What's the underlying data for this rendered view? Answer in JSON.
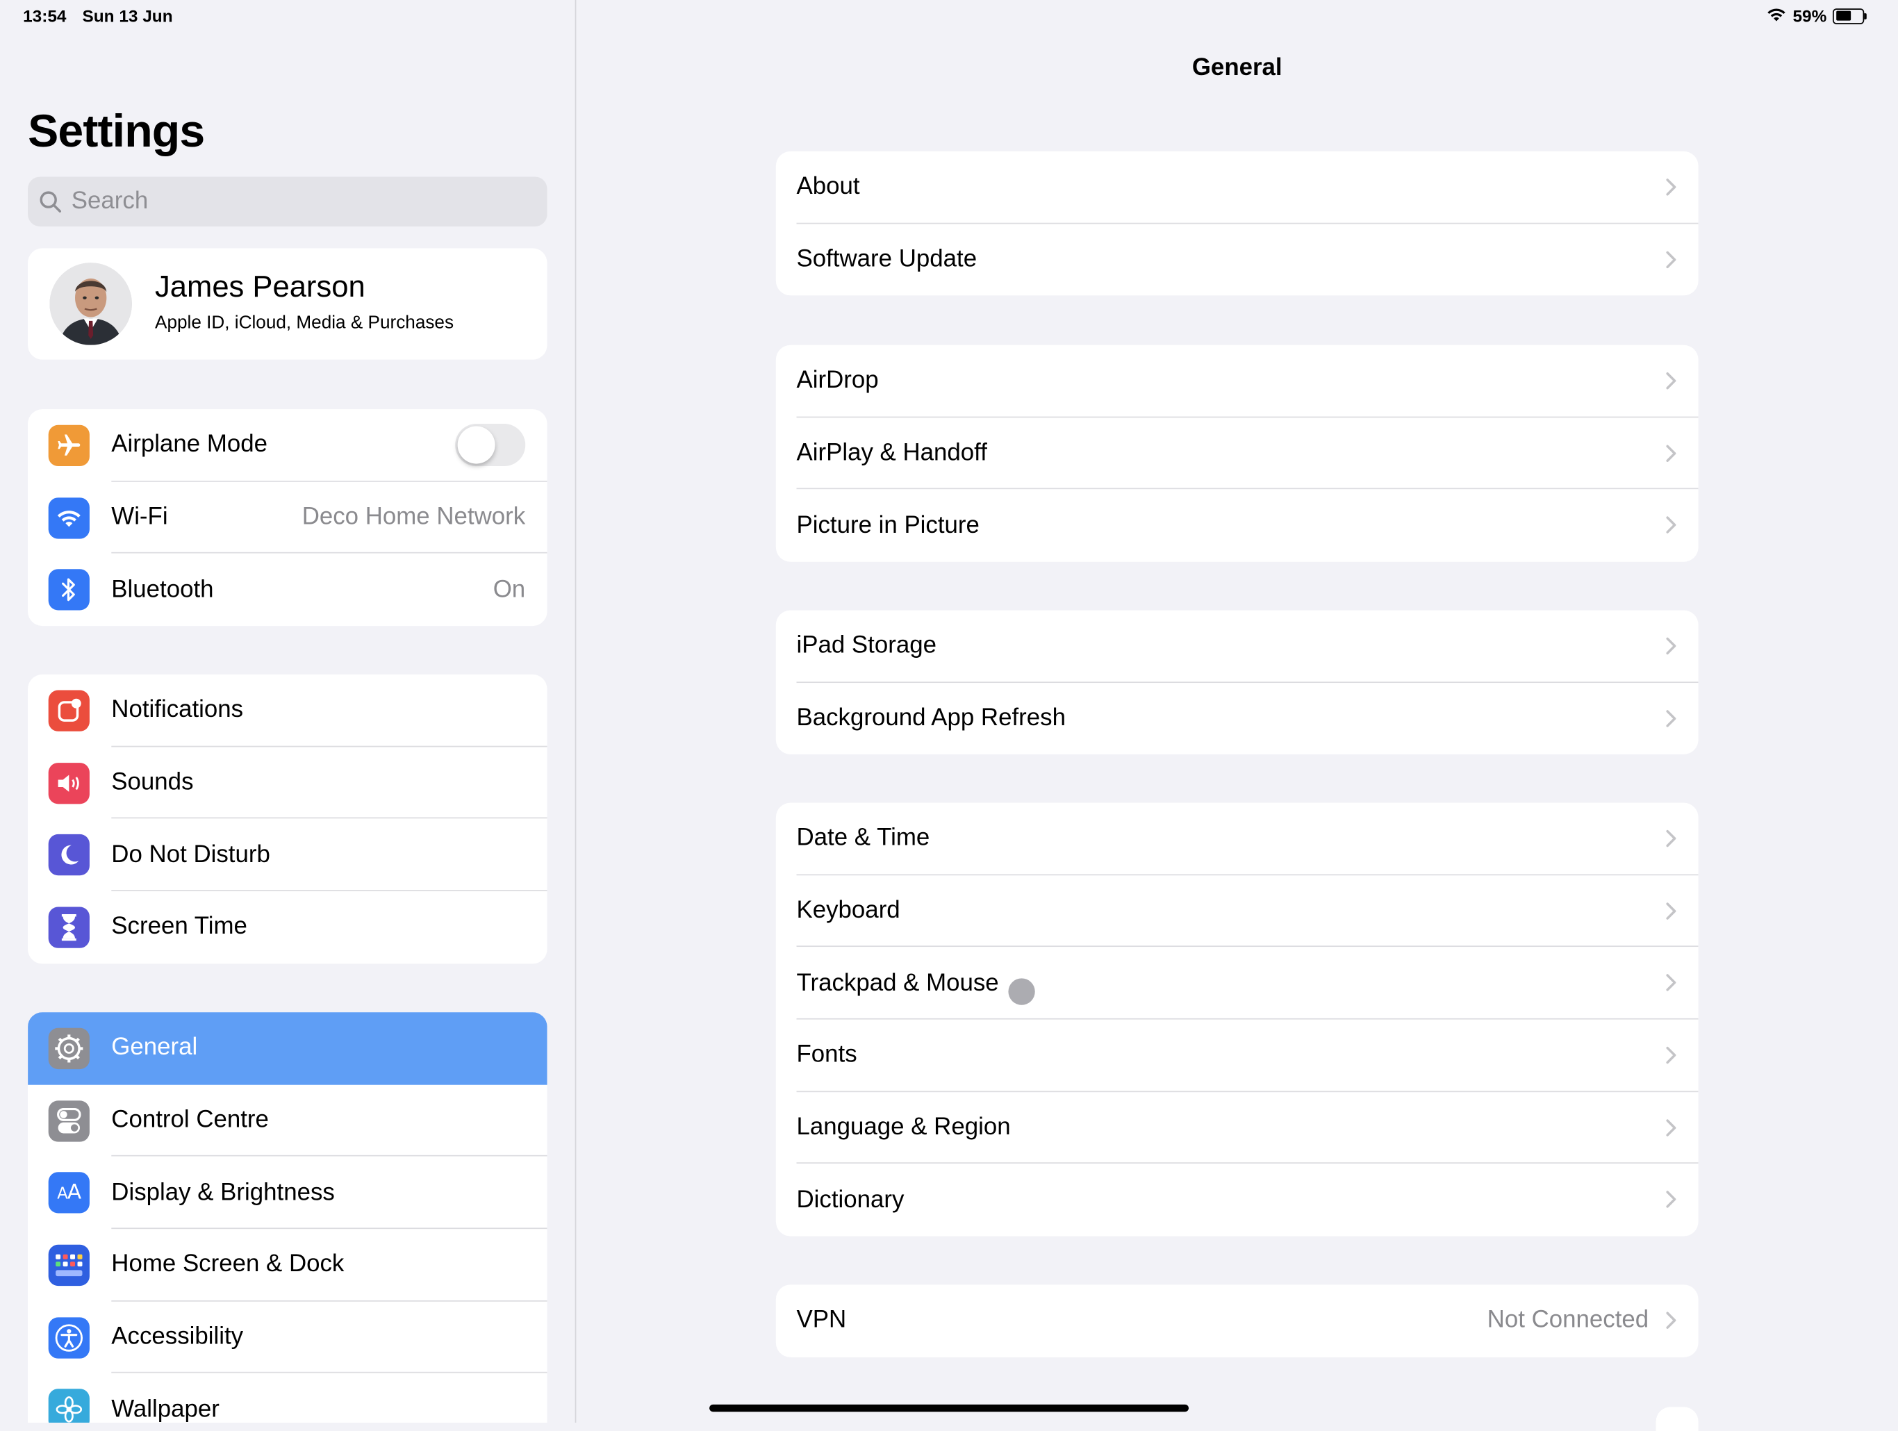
{
  "status_bar": {
    "time": "13:54",
    "date": "Sun 13 Jun",
    "battery": "59%",
    "battery_level": 0.59
  },
  "sidebar": {
    "title": "Settings",
    "search_placeholder": "Search",
    "profile": {
      "name": "James Pearson",
      "subtitle": "Apple ID, iCloud, Media & Purchases"
    },
    "group1": [
      {
        "label": "Airplane Mode",
        "toggle": false,
        "icon": "airplane-icon",
        "color": "#f09a37"
      },
      {
        "label": "Wi-Fi",
        "value": "Deco Home Network",
        "icon": "wifi-icon",
        "color": "#3478f6"
      },
      {
        "label": "Bluetooth",
        "value": "On",
        "icon": "bluetooth-icon",
        "color": "#3478f6"
      }
    ],
    "group2": [
      {
        "label": "Notifications",
        "icon": "notifications-icon",
        "color": "#eb4d3d"
      },
      {
        "label": "Sounds",
        "icon": "speaker-icon",
        "color": "#eb445a"
      },
      {
        "label": "Do Not Disturb",
        "icon": "moon-icon",
        "color": "#5856d6"
      },
      {
        "label": "Screen Time",
        "icon": "hourglass-icon",
        "color": "#5856d6"
      }
    ],
    "group3": [
      {
        "label": "General",
        "icon": "gear-icon",
        "color": "#8e8e93",
        "selected": true
      },
      {
        "label": "Control Centre",
        "icon": "toggles-icon",
        "color": "#8e8e93"
      },
      {
        "label": "Display & Brightness",
        "icon": "text-size-icon",
        "color": "#3478f6"
      },
      {
        "label": "Home Screen & Dock",
        "icon": "app-grid-icon",
        "color": "#2f5fe0"
      },
      {
        "label": "Accessibility",
        "icon": "accessibility-icon",
        "color": "#3478f6"
      },
      {
        "label": "Wallpaper",
        "icon": "flower-icon",
        "color": "#36aadc"
      }
    ]
  },
  "detail": {
    "title": "General",
    "groups": [
      [
        {
          "label": "About"
        },
        {
          "label": "Software Update"
        }
      ],
      [
        {
          "label": "AirDrop"
        },
        {
          "label": "AirPlay & Handoff"
        },
        {
          "label": "Picture in Picture"
        }
      ],
      [
        {
          "label": "iPad Storage"
        },
        {
          "label": "Background App Refresh"
        }
      ],
      [
        {
          "label": "Date & Time"
        },
        {
          "label": "Keyboard"
        },
        {
          "label": "Trackpad & Mouse"
        },
        {
          "label": "Fonts"
        },
        {
          "label": "Language & Region"
        },
        {
          "label": "Dictionary"
        }
      ],
      [
        {
          "label": "VPN",
          "value": "Not Connected"
        }
      ]
    ]
  }
}
